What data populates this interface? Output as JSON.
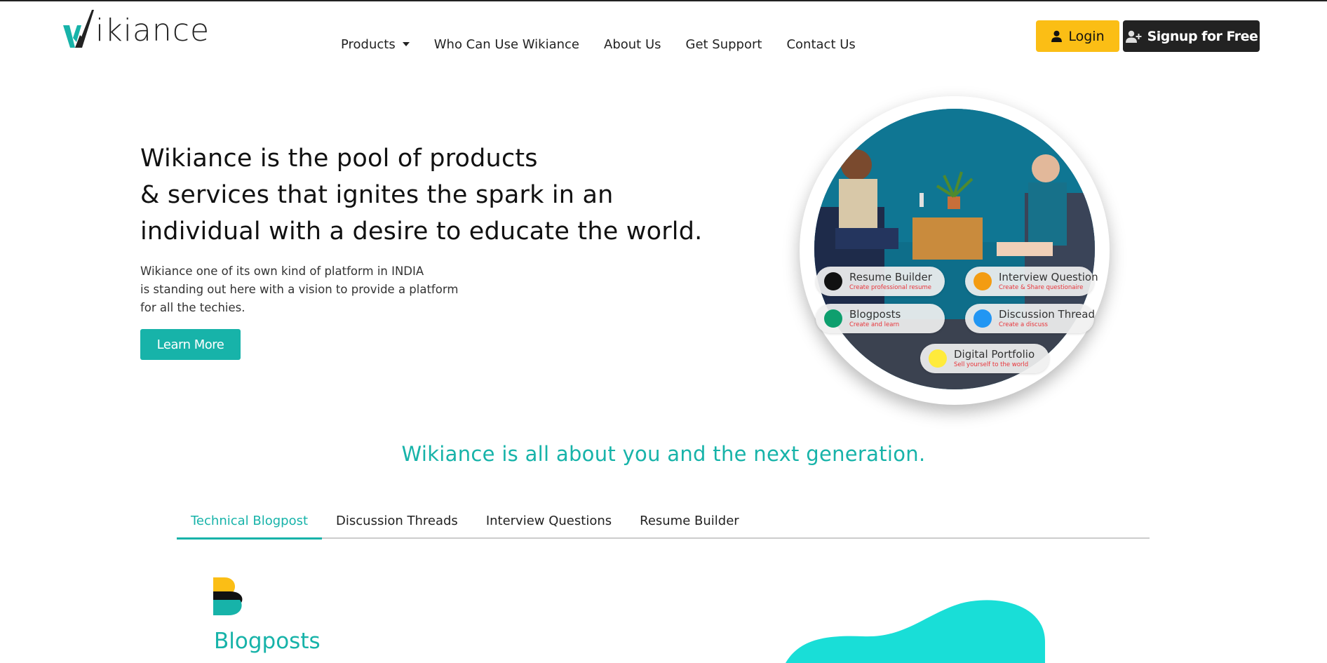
{
  "header": {
    "logo_text": "ikiance",
    "nav": [
      {
        "label": "Products",
        "has_dropdown": true
      },
      {
        "label": "Who Can Use Wikiance"
      },
      {
        "label": "About Us"
      },
      {
        "label": "Get Support"
      },
      {
        "label": "Contact Us"
      }
    ],
    "login_label": "Login",
    "signup_label": "Signup for Free"
  },
  "hero": {
    "title_lines": [
      "Wikiance is the pool of products",
      "& services that ignites the spark in an",
      "individual with a desire to educate the world."
    ],
    "description_lines": [
      "Wikiance one of its own kind of platform in INDIA",
      "is standing out here with a vision to provide a platform",
      "for all the techies."
    ],
    "learn_more_label": "Learn More"
  },
  "feature_pills": [
    {
      "title": "Resume Builder",
      "subtitle": "Create professional resume",
      "dot_color": "#111111"
    },
    {
      "title": "Interview Question",
      "subtitle": "Create & Share questionaire",
      "dot_color": "#f39c12"
    },
    {
      "title": "Blogposts",
      "subtitle": "Create and learn",
      "dot_color": "#0e9f6e"
    },
    {
      "title": "Discussion Thread",
      "subtitle": "Create a discuss",
      "dot_color": "#2196f3"
    },
    {
      "title": "Digital Portfolio",
      "subtitle": "Sell yourself to the world",
      "dot_color": "#ffeb3b"
    }
  ],
  "tagline": "Wikiance is all about you and the next generation.",
  "tabs": [
    {
      "label": "Technical Blogpost",
      "active": true
    },
    {
      "label": "Discussion Threads",
      "active": false
    },
    {
      "label": "Interview Questions",
      "active": false
    },
    {
      "label": "Resume Builder",
      "active": false
    }
  ],
  "content": {
    "section_title": "Blogposts"
  },
  "colors": {
    "accent": "#17b3a9",
    "login_bg": "#fbbe15",
    "signup_bg": "#222222",
    "blob": "#19ded7"
  }
}
